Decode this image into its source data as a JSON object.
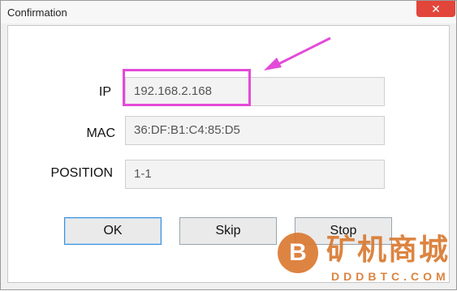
{
  "window": {
    "title": "Confirmation",
    "close_icon": "close-icon"
  },
  "form": {
    "ip_label": "IP",
    "ip_value": "192.168.2.168",
    "mac_label": "MAC",
    "mac_value": "36:DF:B1:C4:85:D5",
    "position_label": "POSITION",
    "position_value": "1-1"
  },
  "buttons": {
    "ok": "OK",
    "skip": "Skip",
    "stop": "Stop"
  },
  "annotation": {
    "highlight_color": "#e44ad8",
    "arrow_color": "#e44ad8"
  },
  "watermark": {
    "logo_letter": "B",
    "text": "矿机商城",
    "subtext": "DDDBTC.COM",
    "color": "#d9772d"
  }
}
